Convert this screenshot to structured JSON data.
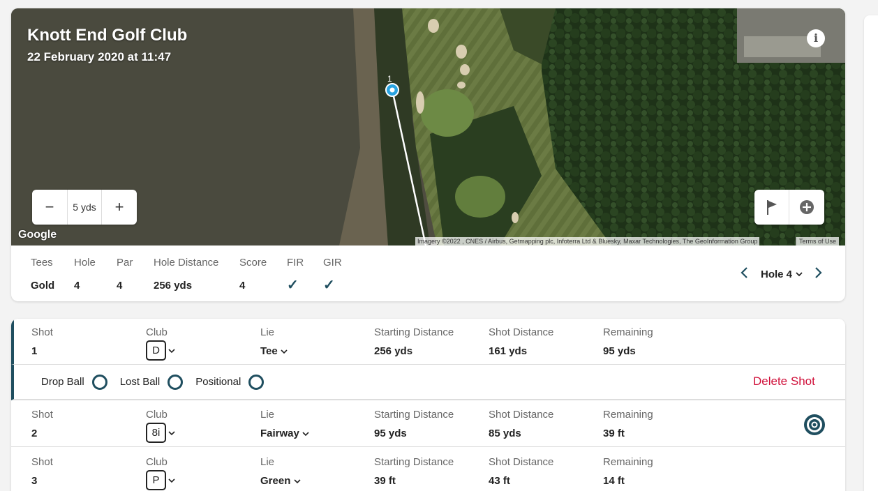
{
  "course": {
    "name": "Knott End Golf Club",
    "date": "22 February 2020 at 11:47"
  },
  "map": {
    "info_label": "i",
    "zoom_minus": "−",
    "zoom_value": "5 yds",
    "zoom_plus": "+",
    "google_logo": "Google",
    "attribution": "Imagery ©2022 , CNES / Airbus, Getmapping plc, Infoterra Ltd & Bluesky, Maxar Technologies, The GeoInformation Group",
    "terms": "Terms of Use",
    "shot_marker_label": "1"
  },
  "hole_stats": {
    "labels": [
      "Tees",
      "Hole",
      "Par",
      "Hole Distance",
      "Score",
      "FIR",
      "GIR"
    ],
    "values": {
      "tees": "Gold",
      "hole": "4",
      "par": "4",
      "hole_distance": "256 yds",
      "score": "4",
      "fir": "✓",
      "gir": "✓"
    },
    "hole_selector": "Hole 4"
  },
  "shot_columns": [
    "Shot",
    "Club",
    "Lie",
    "Starting Distance",
    "Shot Distance",
    "Remaining"
  ],
  "shots": [
    {
      "shot": "1",
      "club": "D",
      "lie": "Tee",
      "start": "256 yds",
      "distance": "161 yds",
      "remaining": "95 yds"
    },
    {
      "shot": "2",
      "club": "8i",
      "lie": "Fairway",
      "start": "95 yds",
      "distance": "85 yds",
      "remaining": "39 ft"
    },
    {
      "shot": "3",
      "club": "P",
      "lie": "Green",
      "start": "39 ft",
      "distance": "43 ft",
      "remaining": "14 ft"
    }
  ],
  "shot_options": {
    "drop_ball": "Drop Ball",
    "lost_ball": "Lost Ball",
    "positional": "Positional",
    "delete": "Delete Shot"
  },
  "colors": {
    "accent": "#1f4e5f",
    "danger": "#d0103a",
    "marker": "#29a3e0"
  }
}
